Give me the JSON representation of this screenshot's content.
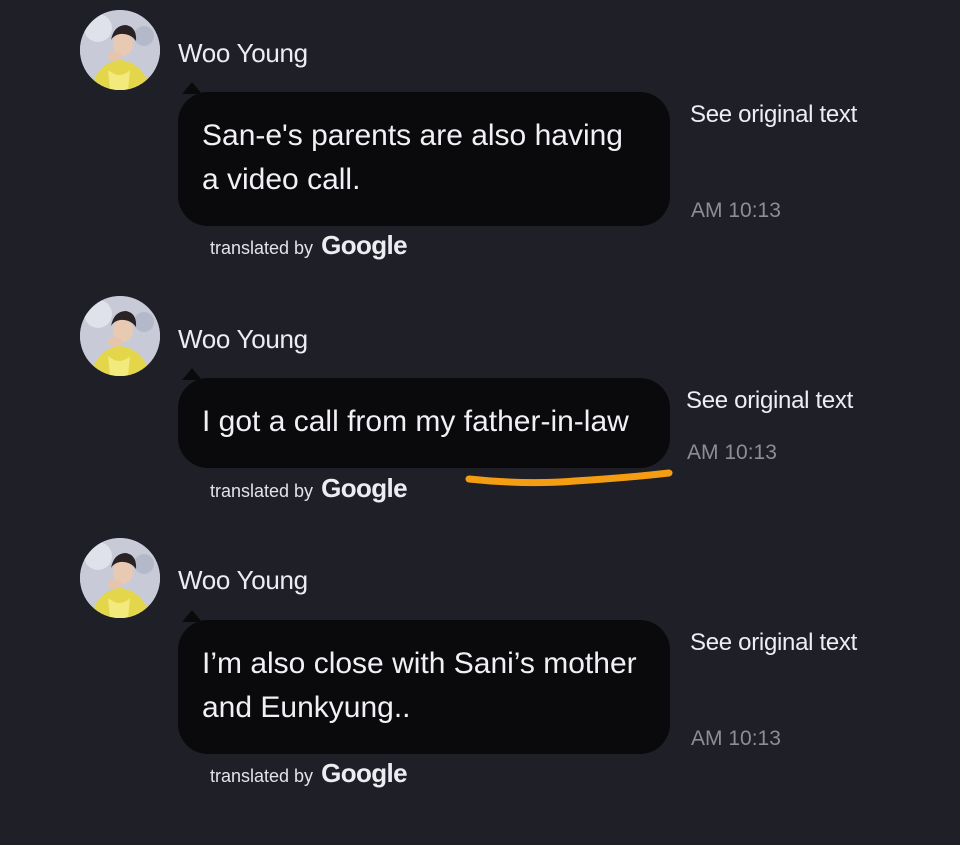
{
  "colors": {
    "background": "#1f1f27",
    "bubble": "#0a0a0d",
    "highlight": "#f59d12"
  },
  "messages": [
    {
      "sender": "Woo Young",
      "text": "San-e's parents are also having a video call.",
      "see_original": "See original text",
      "time": "AM 10:13",
      "translated_prefix": "translated by",
      "translated_brand": "Google"
    },
    {
      "sender": "Woo Young",
      "text": "I got a call from my father-in-law",
      "see_original": "See original text",
      "time": "AM 10:13",
      "translated_prefix": "translated by",
      "translated_brand": "Google",
      "highlighted": true
    },
    {
      "sender": "Woo Young",
      "text": "I’m also close with Sani’s mother and Eunkyung..",
      "see_original": "See original text",
      "time": "AM 10:13",
      "translated_prefix": "translated by",
      "translated_brand": "Google"
    }
  ]
}
